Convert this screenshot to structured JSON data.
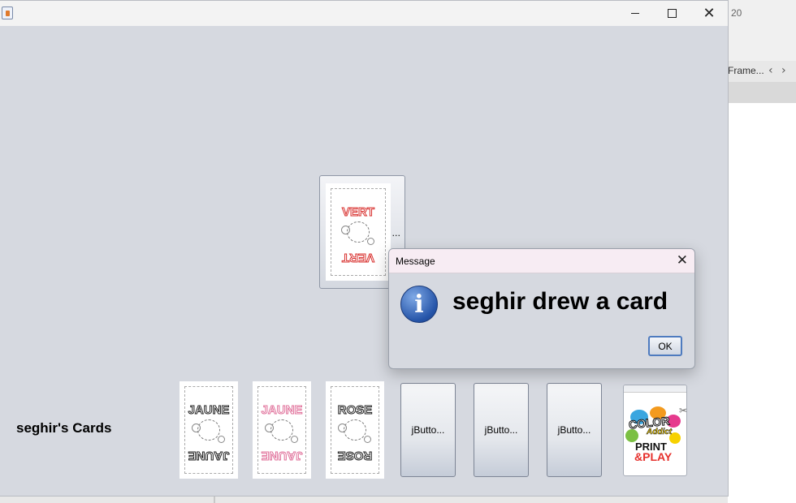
{
  "window": {
    "title": ""
  },
  "background_app": {
    "number": "20",
    "tab_label": "Frame..."
  },
  "player": {
    "label": "seghir's Cards"
  },
  "center_card": {
    "word": "VERT",
    "ellipsis": "..."
  },
  "hand": [
    {
      "word": "JAUNE",
      "style": "black"
    },
    {
      "word": "JAUNE",
      "style": "pink"
    },
    {
      "word": "ROSE",
      "style": "black"
    }
  ],
  "jbuttons": [
    "jButto...",
    "jButto...",
    "jButto..."
  ],
  "deck": {
    "logo_line1": "COLOR",
    "logo_line2": "Addict",
    "logo_line3": "PRINT",
    "logo_line4": "&PLAY"
  },
  "dialog": {
    "title": "Message",
    "message": "seghir drew a card",
    "ok_label": "OK"
  },
  "colors": {
    "window_bg": "#d6d9e0",
    "dialog_title_bg": "#f7ecf3",
    "info_icon": "#2554a8",
    "red_word": "#d8302e",
    "pink_word": "#e0709a"
  }
}
